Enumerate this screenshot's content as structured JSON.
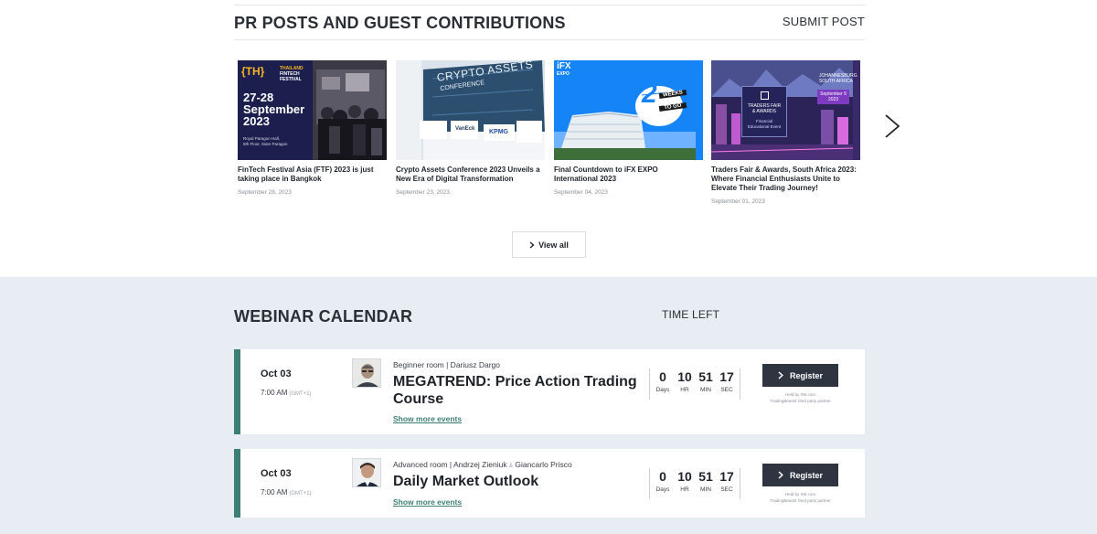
{
  "pr": {
    "title": "PR POSTS AND GUEST CONTRIBUTIONS",
    "submit_label": "SUBMIT POST",
    "view_all_label": "View all",
    "cards": [
      {
        "title": "FinTech Festival Asia (FTF) 2023 is just taking place in Bangkok",
        "date": "September 28, 2023",
        "image": {
          "brand": "{TH}",
          "line1": "THAILAND",
          "line2": "FINTECH",
          "line3": "FESTIVAL",
          "days": "27-28",
          "month": "September",
          "year": "2023",
          "venue1": "Royal Paragon Hall,",
          "venue2": "5th Floor, Siam Paragon"
        }
      },
      {
        "title": "Crypto Assets Conference 2023 Unveils a New Era of Digital Transformation",
        "date": "September 23, 2023",
        "image": {
          "banner1": "CRYPTO ASSETS",
          "banner2": "CONFERENCE",
          "logo1": "VanEck",
          "logo2": "KPMG"
        }
      },
      {
        "title": "Final Countdown to iFX EXPO International 2023",
        "date": "September 04, 2023",
        "image": {
          "brand1": "iFX",
          "brand2": "EXPO",
          "number": "2",
          "weeks": "WEEKS",
          "to_go": "TO GO"
        }
      },
      {
        "title": "Traders Fair & Awards, South Africa 2023: Where Financial Enthusiasts Unite to Elevate Their Trading Journey!",
        "date": "September 01, 2023",
        "image": {
          "city1": "JOHANNESBURG",
          "city2": "SOUTH AFRICA",
          "date1": "September 9",
          "date2": "2023",
          "box1": "TRADERS FAIR",
          "box2": "& AWARDS",
          "box3": "Financial",
          "box4": "Educational Event"
        }
      }
    ]
  },
  "webinar": {
    "title": "WEBINAR CALENDAR",
    "time_left_label": "TIME LEFT",
    "labels": {
      "days": "Days",
      "hr": "HR",
      "min": "MIN",
      "sec": "SEC",
      "register": "Register",
      "show_more": "Show more events",
      "host_line1": "Held by XM.com",
      "host_line2": "TradingBeasts' third party partner",
      "tz": "(GMT+1)"
    },
    "events": [
      {
        "date": "Oct 03",
        "time": "7:00 AM",
        "room": "Beginner room | Dariusz Dargo",
        "name": "MEGATREND: Price Action Trading Course",
        "days": "0",
        "hr": "10",
        "min": "51",
        "sec": "17"
      },
      {
        "date": "Oct 03",
        "time": "7:00 AM",
        "room": "Advanced room | Andrzej Zieniuk",
        "amp": "&",
        "room2": "Giancarlo Prisco",
        "name": "Daily Market Outlook",
        "days": "0",
        "hr": "10",
        "min": "51",
        "sec": "17"
      }
    ]
  },
  "colors": {
    "accent_teal": "#3d7f75",
    "button_dark": "#2f3540",
    "section_bg": "#e7edf3",
    "ftf_navy": "#1c1f4e",
    "ftf_gold": "#f5b622",
    "ifx_blue": "#1584f7",
    "traders_purple": "#3b2a6a"
  },
  "icons": {
    "next": "chevron-right-icon",
    "view_all": "chevron-right-icon",
    "register": "chevron-right-icon"
  }
}
